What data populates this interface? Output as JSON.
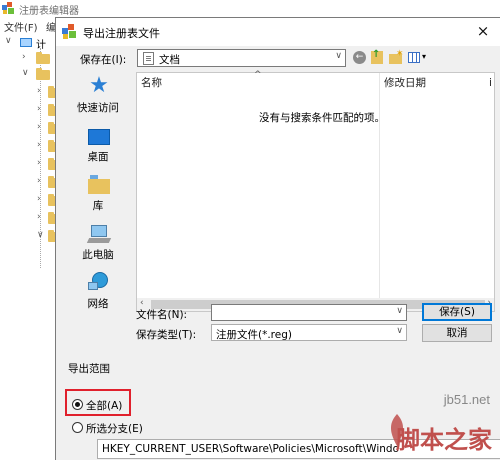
{
  "bg_window": {
    "title": "注册表编辑器",
    "menu": [
      "文件(F)",
      "编"
    ],
    "tree_root": "计算"
  },
  "dialog": {
    "title": "导出注册表文件",
    "close": "×",
    "lookin_label": "保存在(I):",
    "lookin_value": "文档",
    "places": [
      {
        "label": "快速访问",
        "icon": "quick-access-icon"
      },
      {
        "label": "桌面",
        "icon": "desktop-icon"
      },
      {
        "label": "库",
        "icon": "library-icon"
      },
      {
        "label": "此电脑",
        "icon": "this-pc-icon"
      },
      {
        "label": "网络",
        "icon": "network-icon"
      }
    ],
    "columns": [
      "名称",
      "修改日期",
      "i"
    ],
    "empty_message": "没有与搜索条件匹配的项。",
    "filename_label": "文件名(N):",
    "filename_value": "",
    "filetype_label": "保存类型(T):",
    "filetype_value": "注册文件(*.reg)",
    "save_button": "保存(S)",
    "cancel_button": "取消",
    "export_range": {
      "title": "导出范围",
      "all_label": "全部(A)",
      "branch_label": "所选分支(E)",
      "selected": "all",
      "branch_path": "HKEY_CURRENT_USER\\Software\\Policies\\Microsoft\\Windo"
    }
  },
  "watermark": {
    "url": "jb51.net",
    "text": "脚本之家"
  },
  "colors": {
    "highlight_box": "#e0202c",
    "accent": "#0078d7"
  }
}
